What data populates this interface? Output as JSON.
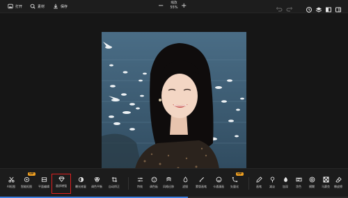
{
  "toolbar": {
    "open_label": "打开",
    "material_label": "素材",
    "save_label": "保存",
    "zoom_label": "缩放",
    "zoom_value": "55%"
  },
  "tools": [
    {
      "label": "AI抠图",
      "icon": "scissors-icon"
    },
    {
      "label": "智能抠图",
      "icon": "smart-cutout-icon",
      "badge": "VIP"
    },
    {
      "label": "平面编辑",
      "icon": "flat-edit-icon"
    },
    {
      "label": "画质增强",
      "icon": "diamond-icon",
      "selected": true
    },
    {
      "label": "曝光修复",
      "icon": "exposure-icon"
    },
    {
      "label": "调色平衡",
      "icon": "color-balance-icon"
    },
    {
      "label": "自动矫正",
      "icon": "crop-icon"
    },
    {
      "label": "特效",
      "icon": "sliders-icon"
    },
    {
      "label": "调色板",
      "icon": "palette-icon"
    },
    {
      "label": "风格迁移",
      "icon": "style-icon"
    },
    {
      "label": "滤镜",
      "icon": "drop-icon"
    },
    {
      "label": "蒙版画笔",
      "icon": "brush-icon"
    },
    {
      "label": "卡通漫画",
      "icon": "cartoon-icon"
    },
    {
      "label": "矢量化",
      "icon": "vector-icon",
      "badge": "VIP"
    },
    {
      "label": "画笔",
      "icon": "pencil-icon"
    },
    {
      "label": "减淡",
      "icon": "dodge-icon"
    },
    {
      "label": "加深",
      "icon": "burn-icon"
    },
    {
      "label": "涂色",
      "icon": "fill-icon"
    },
    {
      "label": "模糊",
      "icon": "blur-icon"
    },
    {
      "label": "马赛克",
      "icon": "mosaic-icon"
    },
    {
      "label": "橡皮擦",
      "icon": "eraser-icon"
    }
  ],
  "progress": 0.54,
  "colors": {
    "accent": "#3d7fe0",
    "selection": "#e02020",
    "badge": "#f0a020"
  }
}
